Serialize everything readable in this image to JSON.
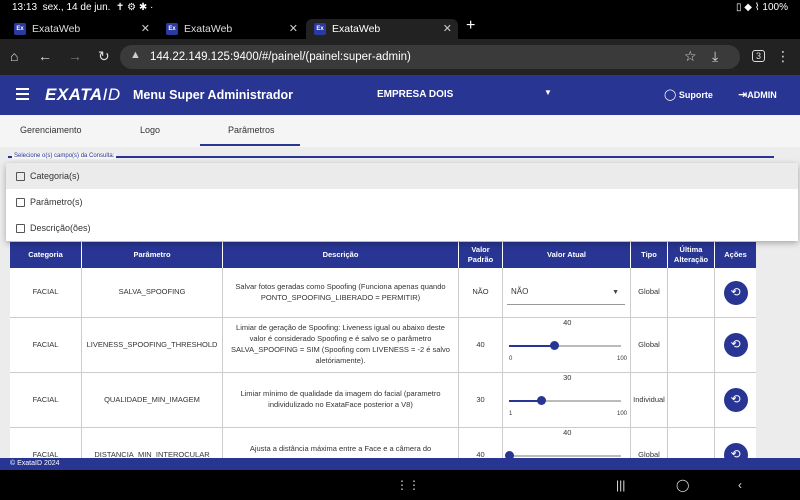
{
  "status": {
    "time": "13:13",
    "date": "sex., 14 de jun.",
    "battery": "100%"
  },
  "browser": {
    "tabs": [
      {
        "favicon": "Ex",
        "title": "ExataWeb"
      },
      {
        "favicon": "Ex",
        "title": "ExataWeb"
      },
      {
        "favicon": "Ex",
        "title": "ExataWeb"
      }
    ],
    "new_tab": "+",
    "url": "144.22.149.125:9400/#/painel/(painel:super-admin)",
    "tab_count": "3"
  },
  "header": {
    "logo_main": "EXATA",
    "logo_id": "ID",
    "title": "Menu Super Administrador",
    "company": "EMPRESA DOIS",
    "support": "Suporte",
    "admin": "ADMIN"
  },
  "tabs": [
    "Gerenciamento",
    "Logo",
    "Parâmetros"
  ],
  "field_label": "Selecione o(s) campo(s) da Consulta:",
  "dropdown_options": [
    "Categoria(s)",
    "Parâmetro(s)",
    "Descrição(ões)"
  ],
  "table": {
    "headers": [
      "Categoria",
      "Parâmetro",
      "Descrição",
      "Valor Padrão",
      "Valor Atual",
      "Tipo",
      "Última Alteração",
      "Ações"
    ],
    "rows": [
      {
        "categoria": "FACIAL",
        "parametro": "SALVA_SPOOFING",
        "descricao": "Salvar fotos geradas como Spoofing (Funciona apenas quando PONTO_SPOOFING_LIBERADO = PERMITIR)",
        "padrao": "NÃO",
        "atual": "NÃO",
        "tipo": "Global"
      },
      {
        "categoria": "FACIAL",
        "parametro": "LIVENESS_SPOOFING_THRESHOLD",
        "descricao": "Limiar de geração de Spoofing: Liveness igual ou abaixo deste valor é considerado Spoofing e é salvo se o parâmetro SALVA_SPOOFING = SIM (Spoofing com LIVENESS = -2 é salvo aletóriamente).",
        "padrao": "40",
        "slider": {
          "value": "40",
          "min": "0",
          "max": "100"
        },
        "tipo": "Global"
      },
      {
        "categoria": "FACIAL",
        "parametro": "QUALIDADE_MIN_IMAGEM",
        "descricao": "Limiar mínimo de qualidade da imagem do facial (parametro individulizado no ExataFace posterior a V8)",
        "padrao": "30",
        "slider": {
          "value": "30",
          "min": "1",
          "max": "100"
        },
        "tipo": "Individual"
      },
      {
        "categoria": "FACIAL",
        "parametro": "DISTANCIA_MIN_INTEROCULAR",
        "descricao": "Ajusta a distância máxima entre a Face e a câmera do",
        "padrao": "40",
        "slider": {
          "value": "40",
          "min": "",
          "max": ""
        },
        "tipo": "Global"
      }
    ]
  },
  "footer": "© ExataID 2024",
  "colors": {
    "primary": "#283593"
  }
}
